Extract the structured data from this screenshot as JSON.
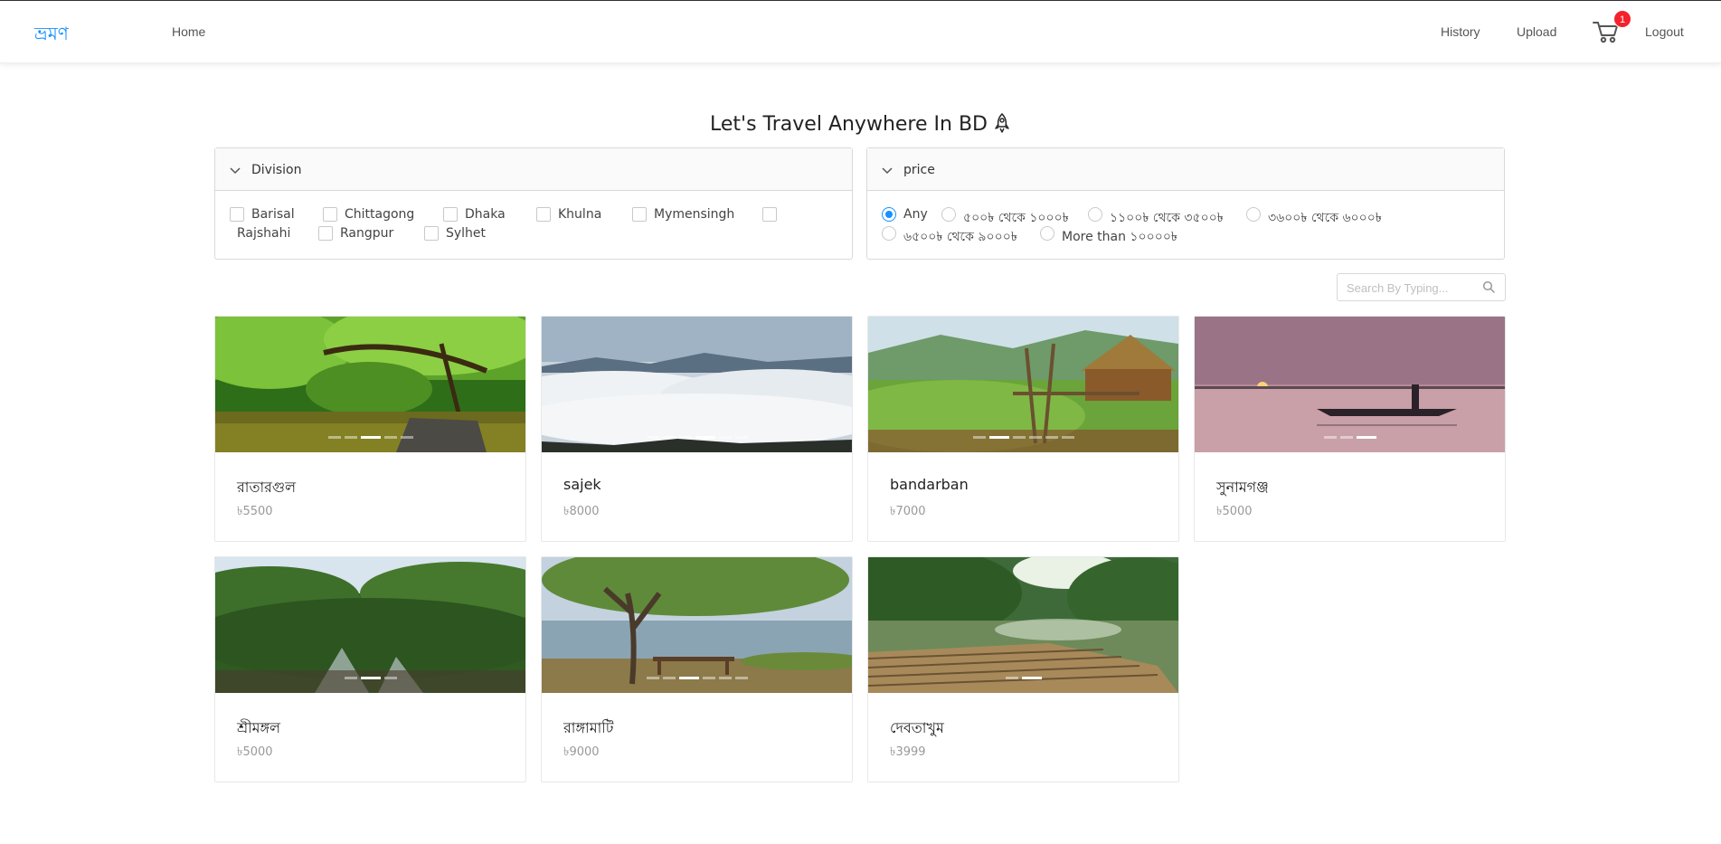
{
  "header": {
    "logo": "ভ্রমণ",
    "home": "Home",
    "history": "History",
    "upload": "Upload",
    "cart_count": "1",
    "logout": "Logout"
  },
  "page": {
    "title": "Let's Travel Anywhere In BD"
  },
  "division": {
    "title": "Division",
    "options": [
      "Barisal",
      "Chittagong",
      "Dhaka",
      "Khulna",
      "Mymensingh",
      "Rajshahi",
      "Rangpur",
      "Sylhet"
    ]
  },
  "price": {
    "title": "price",
    "options": [
      "Any",
      "৫০০৳ থেকে ১০০০৳",
      "১১০০৳ থেকে ৩৫০০৳",
      "৩৬০০৳ থেকে ৬০০০৳",
      "৬৫০০৳ থেকে ৯০০০৳",
      "More than ১০০০০৳"
    ],
    "selected": "Any"
  },
  "search": {
    "placeholder": "Search By Typing..."
  },
  "cards": [
    {
      "name": "রাতারগুল",
      "price": "৳5500",
      "scene": "forest-river"
    },
    {
      "name": "sajek",
      "price": "৳8000",
      "scene": "clouds"
    },
    {
      "name": "bandarban",
      "price": "৳7000",
      "scene": "hill-hut"
    },
    {
      "name": "সুনামগঞ্জ",
      "price": "৳5000",
      "scene": "sunset-boat"
    },
    {
      "name": "শ্রীমঙ্গল",
      "price": "৳5000",
      "scene": "waterfall"
    },
    {
      "name": "রাঙ্গামাটি",
      "price": "৳9000",
      "scene": "lake-tree"
    },
    {
      "name": "দেবতাখুম",
      "price": "৳3999",
      "scene": "bamboo-raft"
    }
  ],
  "colors": {
    "accent": "#1890ff",
    "badge": "#f5222d"
  }
}
